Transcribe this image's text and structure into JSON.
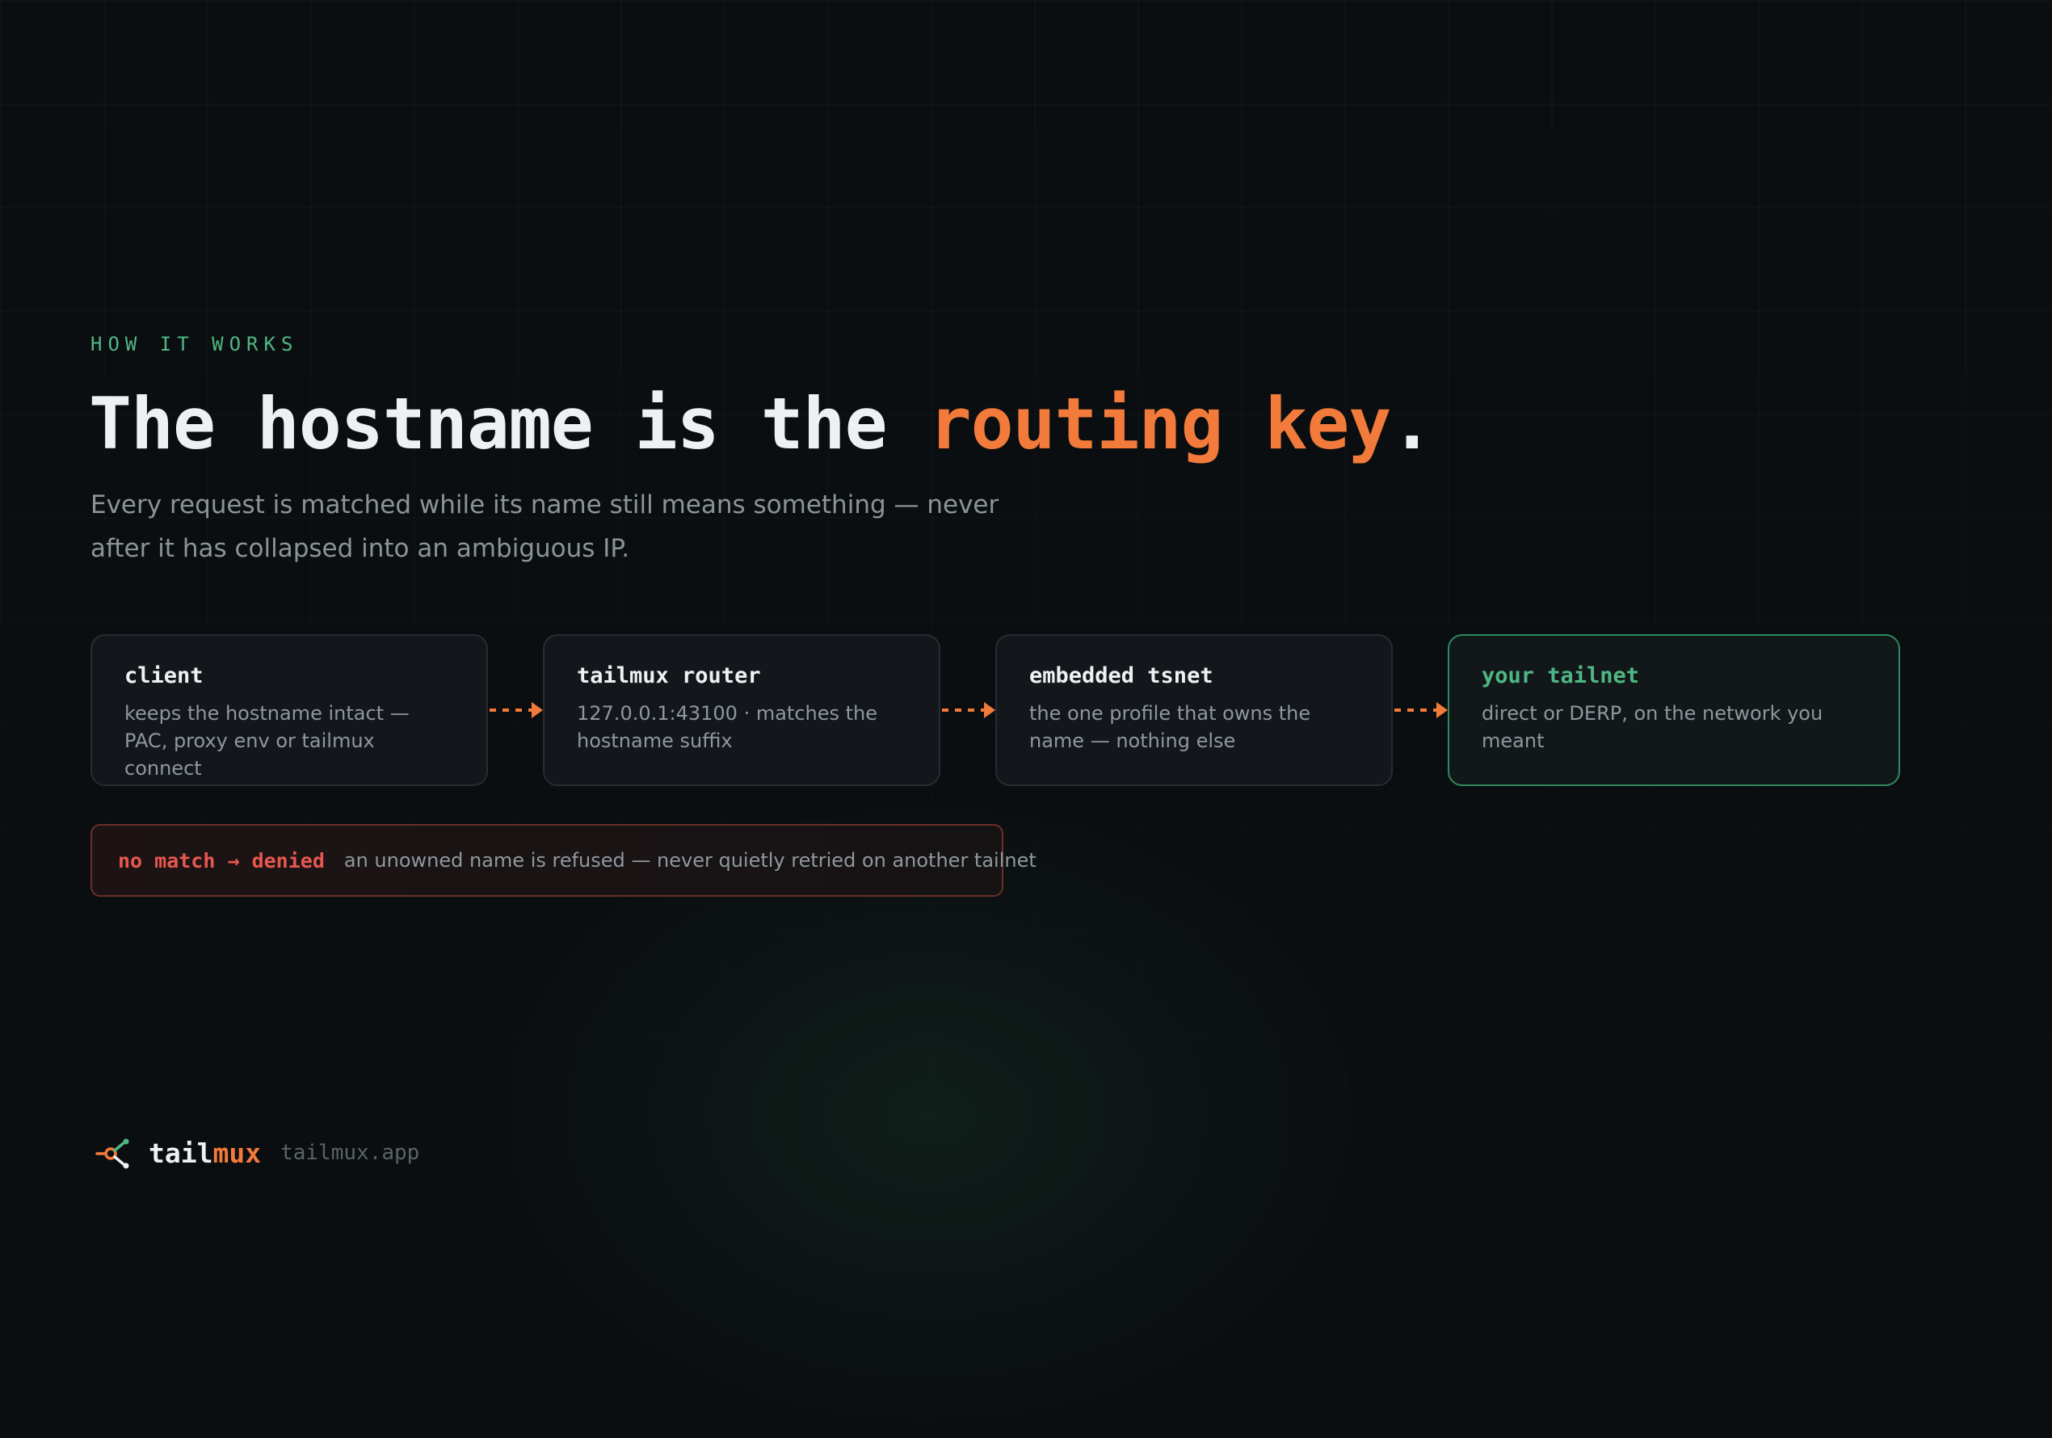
{
  "eyebrow": "HOW IT WORKS",
  "headline": {
    "part1": "The hostname is the ",
    "accent": "routing key",
    "part2": "."
  },
  "subtitle": "Every request is matched while its name still means something — never after it has collapsed into an ambiguous IP.",
  "flow": [
    {
      "title": "client",
      "desc": "keeps the hostname intact — PAC, proxy env or tailmux connect"
    },
    {
      "title": "tailmux router",
      "desc": "127.0.0.1:43100 · matches the hostname suffix"
    },
    {
      "title": "embedded tsnet",
      "desc": "the one profile that owns the name — nothing else"
    },
    {
      "title": "your tailnet",
      "desc": "direct or DERP, on the network you meant"
    }
  ],
  "denied": {
    "tag": "no match → denied",
    "text": "an unowned name is refused — never quietly retried on another tailnet"
  },
  "footer": {
    "brand_part1": "tail",
    "brand_part2": "mux",
    "domain": "tailmux.app"
  },
  "colors": {
    "background": "#0b0e10",
    "accent_orange": "#f27a3a",
    "accent_green": "#4fb783",
    "denied_red": "#e8574f",
    "card_bg": "#13171b",
    "card_border": "#262c31",
    "text_muted": "#8f989d"
  },
  "icons": {
    "arrow": "dashed-arrow-right-icon",
    "logo": "tailmux-logo-icon"
  }
}
